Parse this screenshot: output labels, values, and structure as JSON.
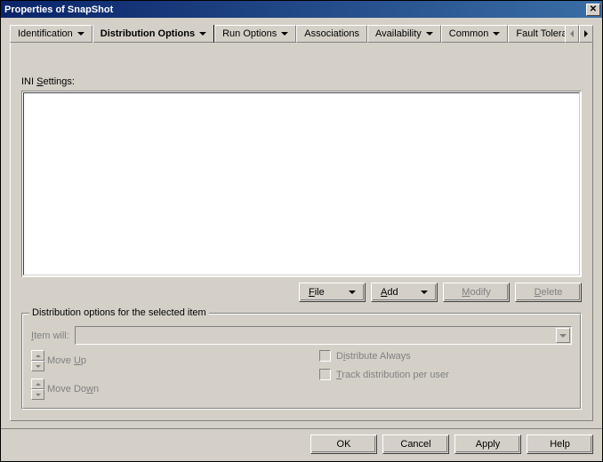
{
  "titlebar": {
    "title": "Properties of SnapShot"
  },
  "tabs": {
    "items": [
      {
        "label": "Identification"
      },
      {
        "label": "Distribution Options",
        "sublabel": "INI Settings"
      },
      {
        "label": "Run Options"
      },
      {
        "label": "Associations"
      },
      {
        "label": "Availability"
      },
      {
        "label": "Common"
      },
      {
        "label": "Fault Toleran"
      }
    ]
  },
  "panel": {
    "ini_label_pre": "INI ",
    "ini_label_u": "S",
    "ini_label_post": "ettings:",
    "file_btn_u": "F",
    "file_btn_post": "ile",
    "add_btn_u": "A",
    "add_btn_post": "dd",
    "modify_btn_u": "M",
    "modify_btn_post": "odify",
    "delete_btn_u": "D",
    "delete_btn_post": "elete"
  },
  "group": {
    "legend": "Distribution options for the selected item",
    "item_will_u": "I",
    "item_will_post": "tem will:",
    "move_up_pre": "Move ",
    "move_up_u": "U",
    "move_up_post": "p",
    "move_down_pre": "Move Do",
    "move_down_u": "w",
    "move_down_post": "n",
    "dist_always_pre": "D",
    "dist_always_u": "i",
    "dist_always_post": "stribute Always",
    "track_u": "T",
    "track_post": "rack distribution per user"
  },
  "footer": {
    "ok": "OK",
    "cancel": "Cancel",
    "apply": "Apply",
    "help": "Help"
  }
}
